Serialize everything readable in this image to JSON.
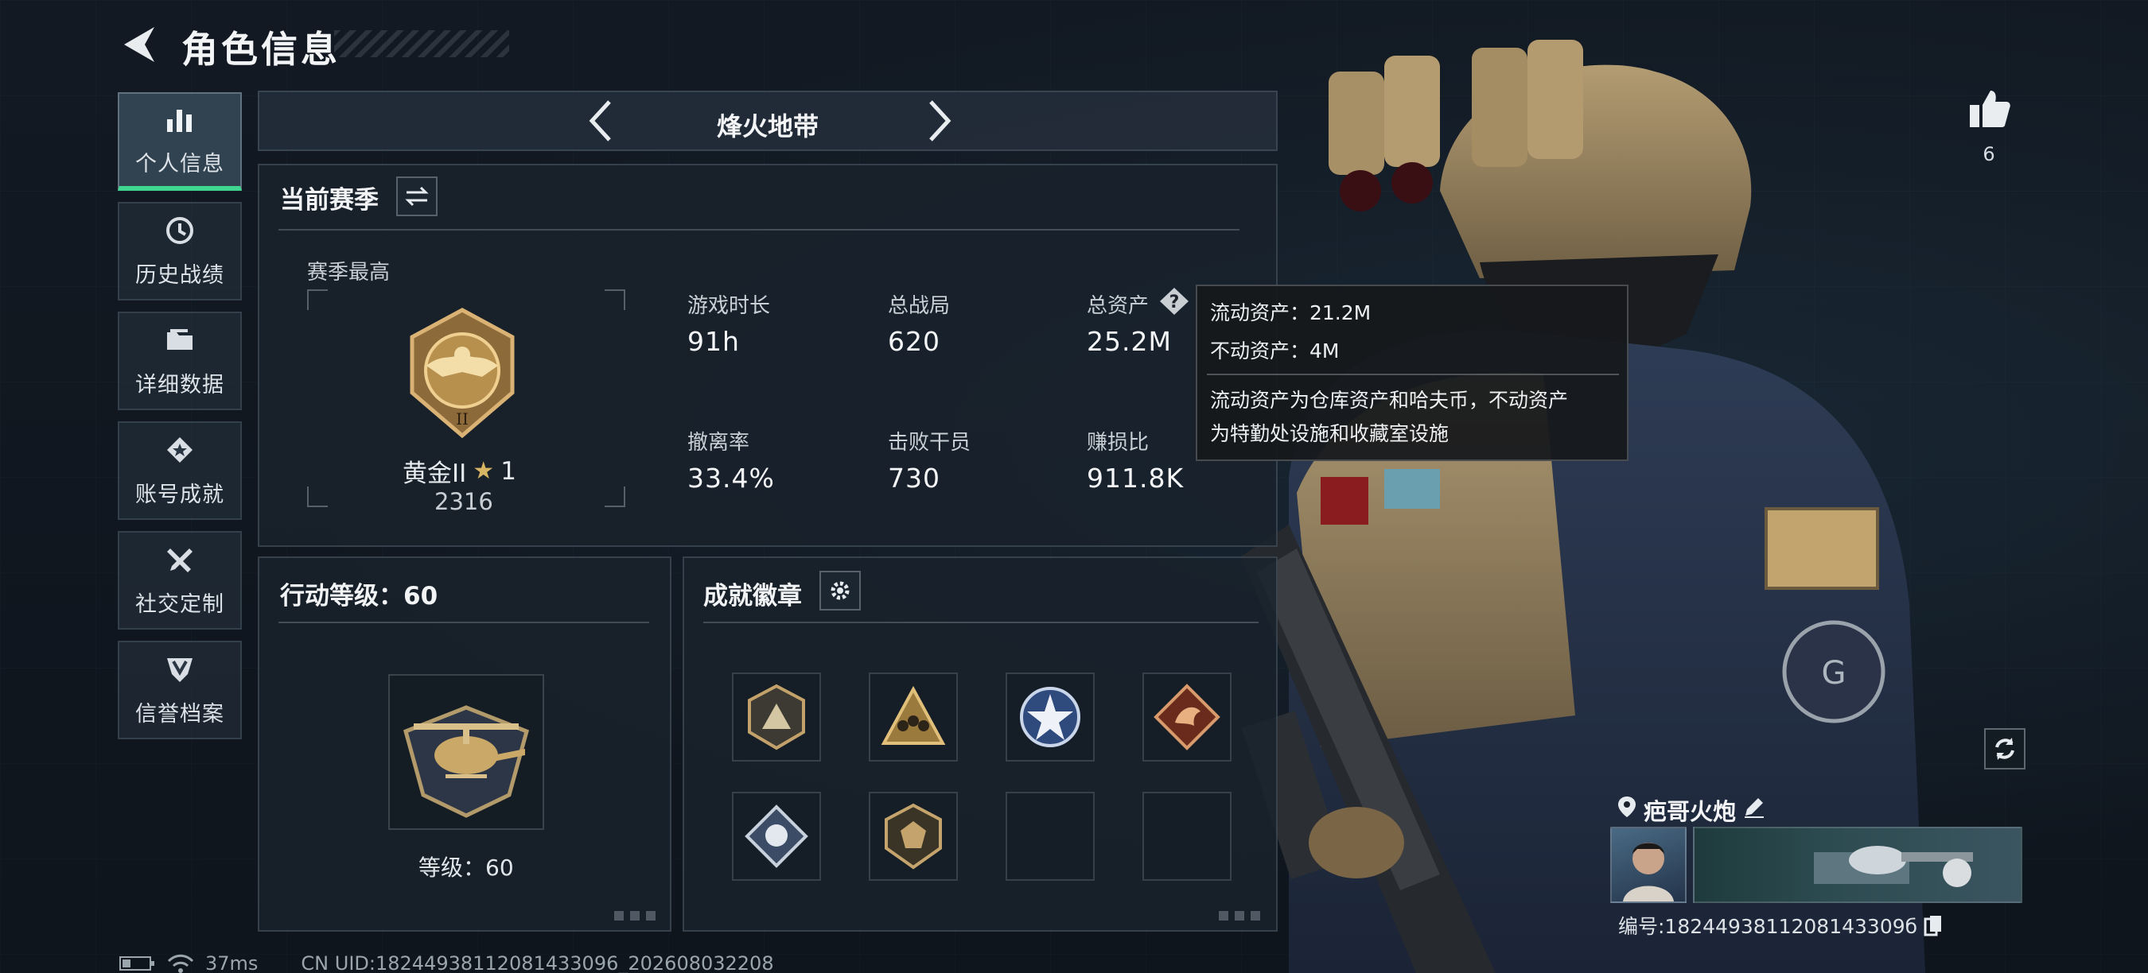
{
  "header": {
    "title": "角色信息"
  },
  "sidebar": {
    "items": [
      {
        "label": "个人信息"
      },
      {
        "label": "历史战绩"
      },
      {
        "label": "详细数据"
      },
      {
        "label": "账号成就"
      },
      {
        "label": "社交定制"
      },
      {
        "label": "信誉档案"
      }
    ]
  },
  "mode_selector": {
    "name": "烽火地带"
  },
  "season": {
    "title": "当前赛季",
    "best_label": "赛季最高",
    "rank_name": "黄金II",
    "rank_stars": "1",
    "rank_points": "2316",
    "stats": [
      {
        "label": "游戏时长",
        "value": "91h"
      },
      {
        "label": "总战局",
        "value": "620"
      },
      {
        "label": "总资产",
        "value": "25.2M"
      },
      {
        "label": "撤离率",
        "value": "33.4%"
      },
      {
        "label": "击败干员",
        "value": "730"
      },
      {
        "label": "赚损比",
        "value": "911.8K"
      }
    ]
  },
  "tooltip": {
    "liquid": "流动资产：21.2M",
    "fixed": "不动资产：4M",
    "desc_line1": "流动资产为仓库资产和哈夫币，不动资产",
    "desc_line2": "为特勤处设施和收藏室设施"
  },
  "action_level": {
    "title": "行动等级：60",
    "level_text": "等级：60"
  },
  "badges": {
    "title": "成就徽章"
  },
  "likes": {
    "count": "6"
  },
  "player": {
    "name": "疤哥火炮",
    "id_text": "编号:1824493811208143309б"
  },
  "footer": {
    "ping": "37ms",
    "uid": "CN UID:18244938112081433096_202608032208"
  },
  "colors": {
    "accent_green": "#3fd68f",
    "gold": "#c8a15a",
    "panel_bg": "#1a222c"
  }
}
